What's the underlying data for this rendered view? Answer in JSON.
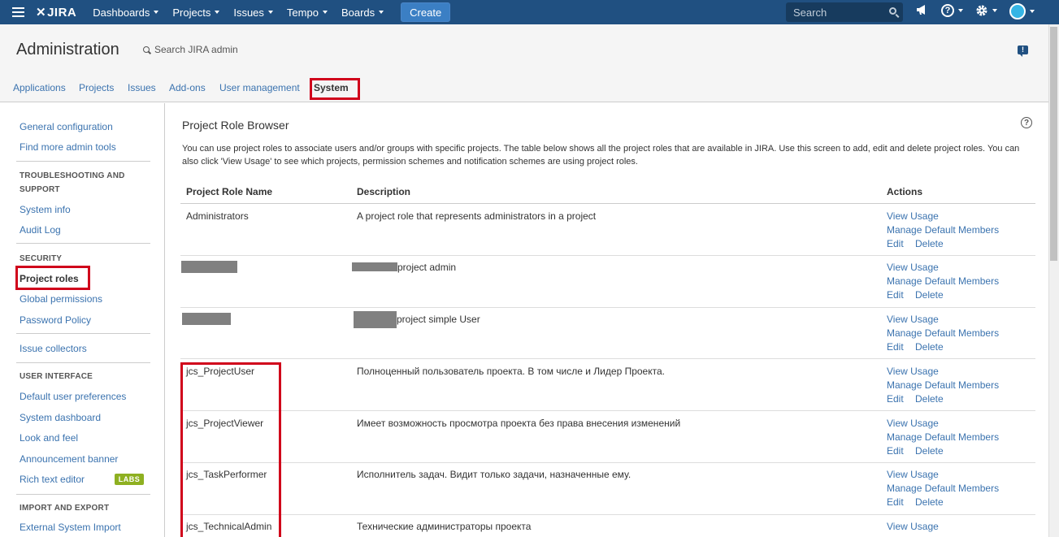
{
  "topnav": {
    "logo": "JIRA",
    "items": [
      {
        "label": "Dashboards"
      },
      {
        "label": "Projects"
      },
      {
        "label": "Issues"
      },
      {
        "label": "Tempo"
      },
      {
        "label": "Boards"
      }
    ],
    "create_label": "Create",
    "search_placeholder": "Search",
    "help_glyph": "?"
  },
  "header": {
    "title": "Administration",
    "search_label": "Search JIRA admin",
    "feedback_glyph": "!"
  },
  "tabs": [
    {
      "label": "Applications"
    },
    {
      "label": "Projects"
    },
    {
      "label": "Issues"
    },
    {
      "label": "Add-ons"
    },
    {
      "label": "User management"
    },
    {
      "label": "System"
    }
  ],
  "sidebar": {
    "general_configuration": "General configuration",
    "find_more_admin_tools": "Find more admin tools",
    "troubleshooting_heading": "TROUBLESHOOTING AND SUPPORT",
    "system_info": "System info",
    "audit_log": "Audit Log",
    "security_heading": "SECURITY",
    "project_roles": "Project roles",
    "global_permissions": "Global permissions",
    "password_policy": "Password Policy",
    "issue_collectors": "Issue collectors",
    "user_interface_heading": "USER INTERFACE",
    "default_user_preferences": "Default user preferences",
    "system_dashboard": "System dashboard",
    "look_and_feel": "Look and feel",
    "announcement_banner": "Announcement banner",
    "rich_text_editor": "Rich text editor",
    "labs_badge": "LABS",
    "import_export_heading": "IMPORT AND EXPORT",
    "external_system_import": "External System Import"
  },
  "main": {
    "title": "Project Role Browser",
    "help_glyph": "?",
    "description": "You can use project roles to associate users and/or groups with specific projects. The table below shows all the project roles that are available in JIRA. Use this screen to add, edit and delete project roles. You can also click 'View Usage' to see which projects, permission schemes and notification schemes are using project roles.",
    "table": {
      "headers": {
        "name": "Project Role Name",
        "description": "Description",
        "actions": "Actions"
      },
      "actions": {
        "view_usage": "View Usage",
        "manage_members": "Manage Default Members",
        "edit": "Edit",
        "delete": "Delete"
      },
      "rows": [
        {
          "name": "Administrators",
          "description": "A project role that represents administrators in a project"
        },
        {
          "name": "",
          "description": "project admin"
        },
        {
          "name": "",
          "description": "project simple User"
        },
        {
          "name": "jcs_ProjectUser",
          "description": "Полноценный пользователь проекта. В том числе и Лидер Проекта."
        },
        {
          "name": "jcs_ProjectViewer",
          "description": "Имеет возможность просмотра проекта без права внесения изменений"
        },
        {
          "name": "jcs_TaskPerformer",
          "description": "Исполнитель задач. Видит только задачи, назначенные ему."
        },
        {
          "name": "jcs_TechnicalAdmin",
          "description": "Технические администраторы проекта"
        }
      ]
    }
  },
  "colors": {
    "nav_bg": "#205081",
    "link": "#3b73af",
    "highlight": "#d0021b",
    "labs": "#8eb021"
  }
}
